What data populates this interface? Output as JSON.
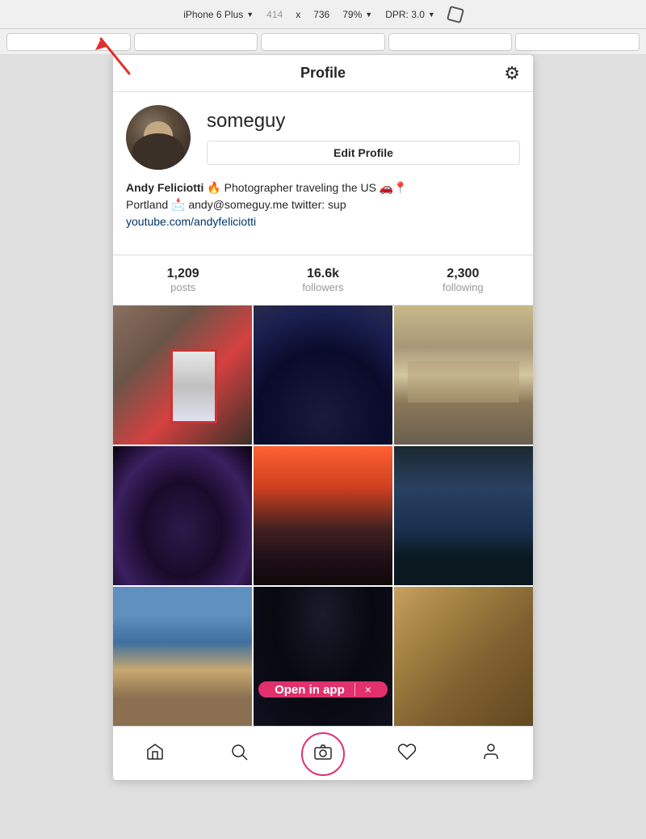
{
  "toolbar": {
    "device_name": "iPhone 6 Plus",
    "dimension_x": "414",
    "dimension_separator": "x",
    "dimension_y": "736",
    "zoom_percent": "79%",
    "dpr_label": "DPR: 3.0"
  },
  "instagram": {
    "header": {
      "title": "Profile",
      "gear_label": "settings"
    },
    "profile": {
      "username": "someguy",
      "edit_button_label": "Edit Profile",
      "bio_name": "Andy Feliciotti",
      "bio_text": "🔥 Photographer traveling the US 🚗📍",
      "bio_line2": "Portland 📩 andy@someguy.me twitter: sup",
      "bio_link": "youtube.com/andyfeliciotti",
      "bio_link_url": "https://youtube.com/andyfeliciotti"
    },
    "stats": [
      {
        "value": "1,209",
        "label": "posts"
      },
      {
        "value": "16.6k",
        "label": "followers"
      },
      {
        "value": "2,300",
        "label": "following"
      }
    ],
    "open_in_app": {
      "label": "Open in app",
      "close": "×"
    },
    "nav": {
      "home_label": "home",
      "search_label": "search",
      "camera_label": "camera",
      "heart_label": "activity",
      "profile_label": "profile"
    }
  }
}
